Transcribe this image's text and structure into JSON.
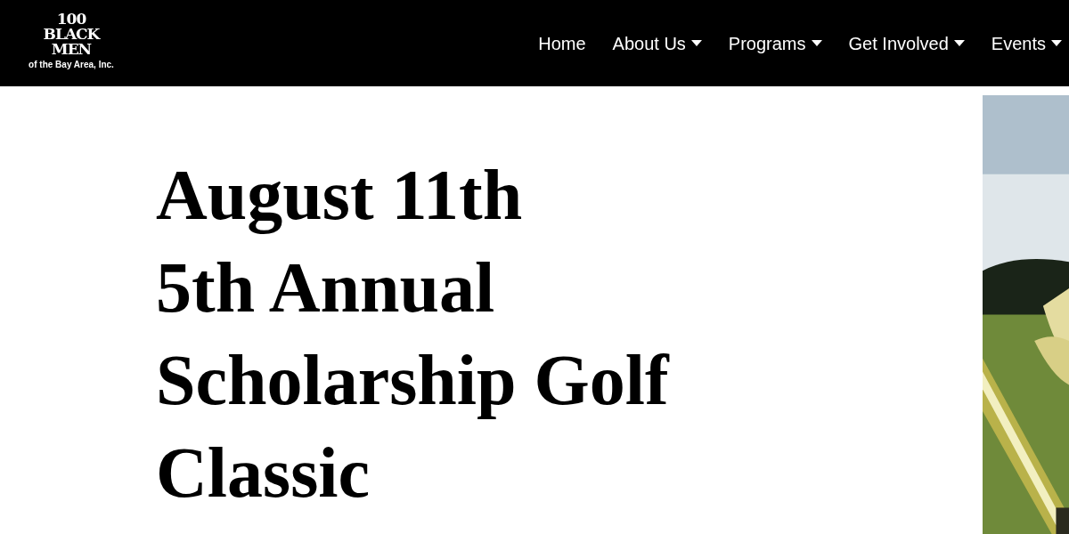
{
  "logo": {
    "lines": [
      "100",
      "BLACK",
      "MEN"
    ],
    "tagline": "of the Bay Area, Inc."
  },
  "nav": [
    {
      "label": "Home",
      "dropdown": false
    },
    {
      "label": "About Us",
      "dropdown": true
    },
    {
      "label": "Programs",
      "dropdown": true
    },
    {
      "label": "Get Involved",
      "dropdown": true
    },
    {
      "label": "Events",
      "dropdown": true
    }
  ],
  "heading": [
    "August 11th",
    "5th Annual",
    "Scholarship Golf",
    "Classic"
  ],
  "hero": {
    "kind": "picture"
  }
}
